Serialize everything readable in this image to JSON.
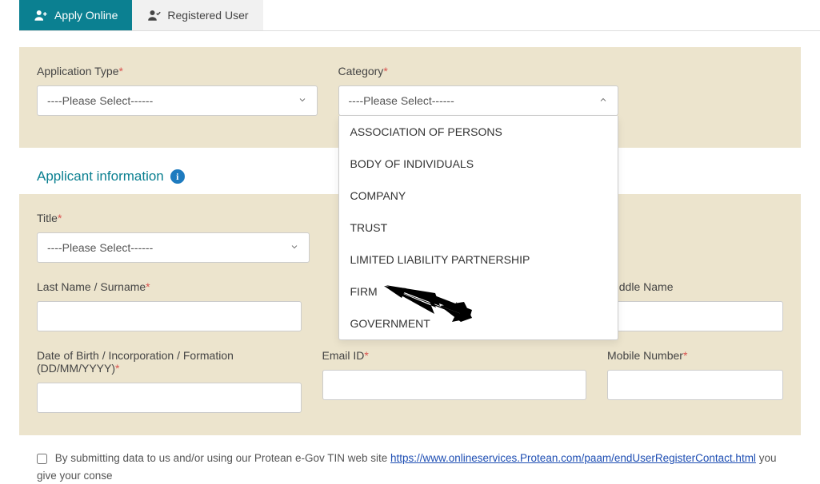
{
  "tabs": {
    "apply": "Apply Online",
    "registered": "Registered User"
  },
  "form": {
    "applicationType": {
      "label": "Application Type",
      "value": "----Please Select------"
    },
    "category": {
      "label": "Category",
      "value": "----Please Select------",
      "options": [
        "ASSOCIATION OF PERSONS",
        "BODY OF INDIVIDUALS",
        "COMPANY",
        "TRUST",
        "LIMITED LIABILITY PARTNERSHIP",
        "FIRM",
        "GOVERNMENT"
      ]
    },
    "sectionHeader": "Applicant information",
    "title": {
      "label": "Title",
      "value": "----Please Select------"
    },
    "lastName": {
      "label": "Last Name / Surname"
    },
    "middleName": {
      "label": "Middle Name"
    },
    "dob": {
      "label": "Date of Birth / Incorporation / Formation (DD/MM/YYYY)"
    },
    "email": {
      "label": "Email ID"
    },
    "mobile": {
      "label": "Mobile Number"
    }
  },
  "consent": {
    "prefix": "By submitting data to us and/or using our Protean e-Gov TIN web site ",
    "linkText": "https://www.onlineservices.Protean.com/paam/endUserRegisterContact.html",
    "suffix": " you give your conse"
  }
}
